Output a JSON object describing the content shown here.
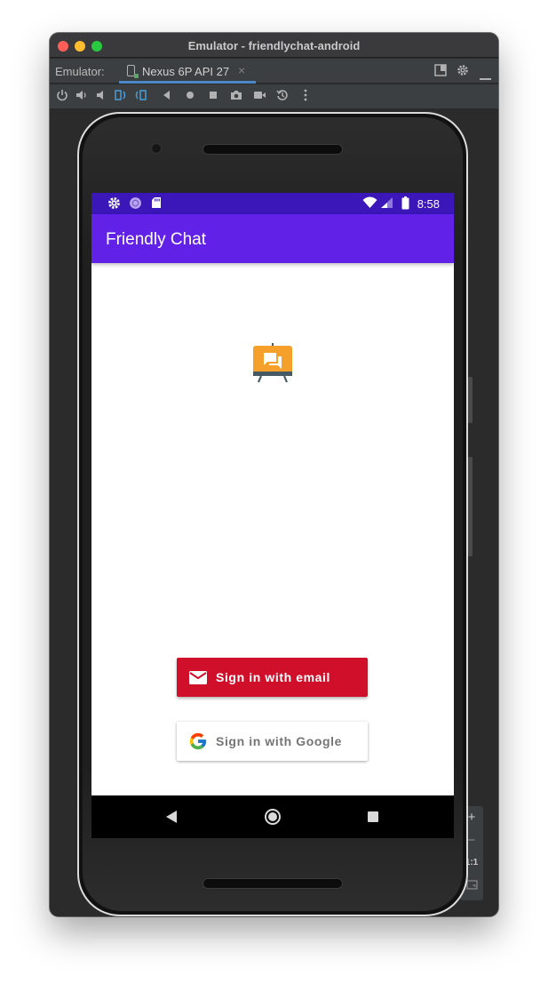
{
  "window": {
    "title": "Emulator - friendlychat-android"
  },
  "tabbar": {
    "prefix": "Emulator:",
    "tab_label": "Nexus 6P API 27",
    "close_glyph": "×"
  },
  "toolbar": {
    "icons": [
      "power-icon",
      "volume-up-icon",
      "volume-down-icon",
      "rotate-left-icon",
      "rotate-right-icon",
      "back-icon",
      "home-icon",
      "overview-icon",
      "screenshot-icon",
      "screenrecord-icon",
      "snapshot-icon",
      "more-icon"
    ]
  },
  "side_panel": {
    "zoom_in": "+",
    "zoom_out": "−",
    "actual_size": "1:1"
  },
  "statusbar": {
    "time": "8:58"
  },
  "app": {
    "title": "Friendly Chat",
    "email_button_label": "Sign in with email",
    "google_button_label": "Sign in with Google"
  },
  "colors": {
    "status_bar": "#3b16b8",
    "app_bar": "#6121e6",
    "email_button": "#d0102b",
    "logo_orange": "#f4a02a"
  }
}
